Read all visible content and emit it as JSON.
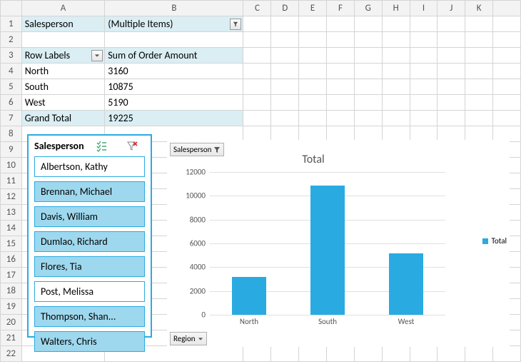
{
  "columns": [
    "A",
    "B",
    "C",
    "D",
    "E",
    "F",
    "G",
    "H",
    "I",
    "J",
    "K"
  ],
  "pivot": {
    "filter_field": "Salesperson",
    "filter_value": "(Multiple Items)",
    "row_labels_header": "Row Labels",
    "value_header": "Sum of Order Amount",
    "rows": [
      {
        "label": "North",
        "value": "3160"
      },
      {
        "label": "South",
        "value": "10875"
      },
      {
        "label": "West",
        "value": "5190"
      }
    ],
    "grand_total_label": "Grand Total",
    "grand_total_value": "19225"
  },
  "slicer": {
    "title": "Salesperson",
    "items": [
      {
        "label": "Albertson, Kathy",
        "selected": false
      },
      {
        "label": "Brennan, Michael",
        "selected": true
      },
      {
        "label": "Davis, William",
        "selected": true
      },
      {
        "label": "Dumlao, Richard",
        "selected": true
      },
      {
        "label": "Flores, Tia",
        "selected": true
      },
      {
        "label": "Post, Melissa",
        "selected": false
      },
      {
        "label": "Thompson, Shan...",
        "selected": true
      },
      {
        "label": "Walters, Chris",
        "selected": true
      }
    ]
  },
  "chart_data": {
    "type": "bar",
    "title": "Total",
    "categories": [
      "North",
      "South",
      "West"
    ],
    "values": [
      3160,
      10875,
      5190
    ],
    "ylim": [
      0,
      12000
    ],
    "ytick_step": 2000,
    "legend": {
      "label": "Total",
      "color": "#29abe2"
    },
    "filter_button": "Salesperson",
    "axis_button": "Region"
  }
}
